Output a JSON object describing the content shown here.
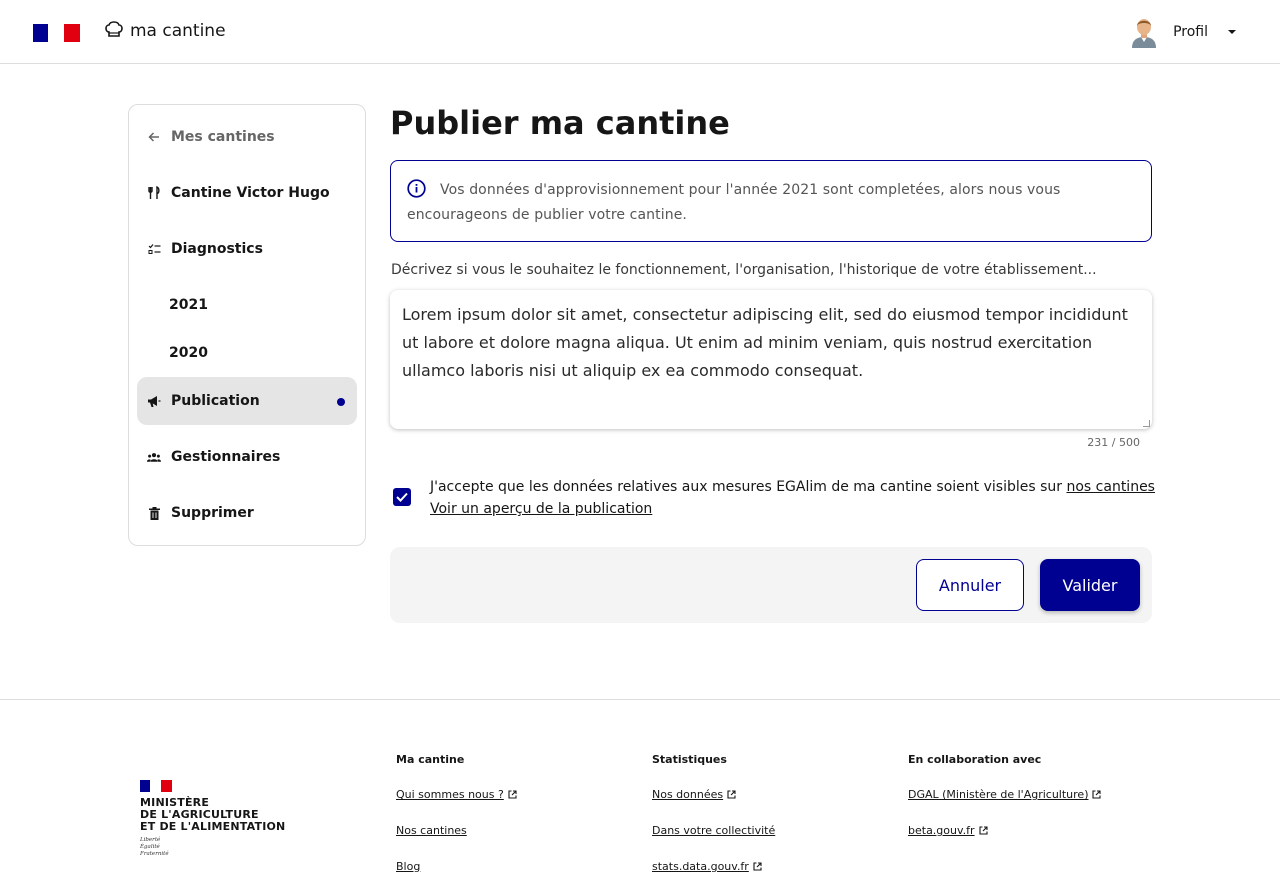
{
  "header": {
    "brand_name": "ma cantine",
    "profile_label": "Profil"
  },
  "sidebar": {
    "items": [
      {
        "label": "Mes cantines",
        "icon": "arrow-left-icon"
      },
      {
        "label": "Cantine Victor Hugo",
        "icon": "restaurant-icon"
      },
      {
        "label": "Diagnostics",
        "icon": "checklist-icon"
      },
      {
        "label": "2021"
      },
      {
        "label": "2020"
      },
      {
        "label": "Publication",
        "icon": "megaphone-icon",
        "active": true
      },
      {
        "label": "Gestionnaires",
        "icon": "team-icon"
      },
      {
        "label": "Supprimer",
        "icon": "trash-icon"
      }
    ]
  },
  "main": {
    "title": "Publier ma cantine",
    "info_text": "Vos données d'approvisionnement pour l'année 2021 sont completées, alors nous vous encourageons de publier votre cantine.",
    "description_label": "Décrivez si vous le souhaitez le fonctionnement, l'organisation, l'historique de votre établissement...",
    "description_value": "Lorem ipsum dolor sit amet, consectetur adipiscing elit, sed do eiusmod tempor incididunt ut labore et dolore magna aliqua. Ut enim ad minim veniam, quis nostrud exercitation ullamco laboris nisi ut aliquip ex ea commodo consequat.",
    "char_counter": "231 / 500",
    "accept_text": "J'accepte que les données relatives aux mesures EGAlim de ma cantine soient visibles sur",
    "accept_link": "nos cantines",
    "accept_checked": true,
    "preview_link": "Voir un aperçu de la publication",
    "cancel_label": "Annuler",
    "submit_label": "Valider"
  },
  "footer": {
    "ministry_lines": [
      "MINISTÈRE",
      "DE L'AGRICULTURE",
      "ET DE L'ALIMENTATION"
    ],
    "motto": [
      "Liberté",
      "Égalité",
      "Fraternité"
    ],
    "columns": [
      {
        "title": "Ma cantine",
        "links": [
          {
            "label": "Qui sommes nous ?",
            "external": true
          },
          {
            "label": "Nos cantines",
            "external": false
          },
          {
            "label": "Blog",
            "external": false
          }
        ]
      },
      {
        "title": "Statistiques",
        "links": [
          {
            "label": "Nos données",
            "external": true
          },
          {
            "label": "Dans votre collectivité",
            "external": false
          },
          {
            "label": "stats.data.gouv.fr",
            "external": true
          }
        ]
      },
      {
        "title": "En collaboration avec",
        "links": [
          {
            "label": "DGAL (Ministère de l'Agriculture)",
            "external": true
          },
          {
            "label": "beta.gouv.fr",
            "external": true
          }
        ]
      }
    ]
  },
  "colors": {
    "primary": "#000091",
    "accent_red": "#e1000f",
    "active_bg": "#e5e5e5"
  }
}
